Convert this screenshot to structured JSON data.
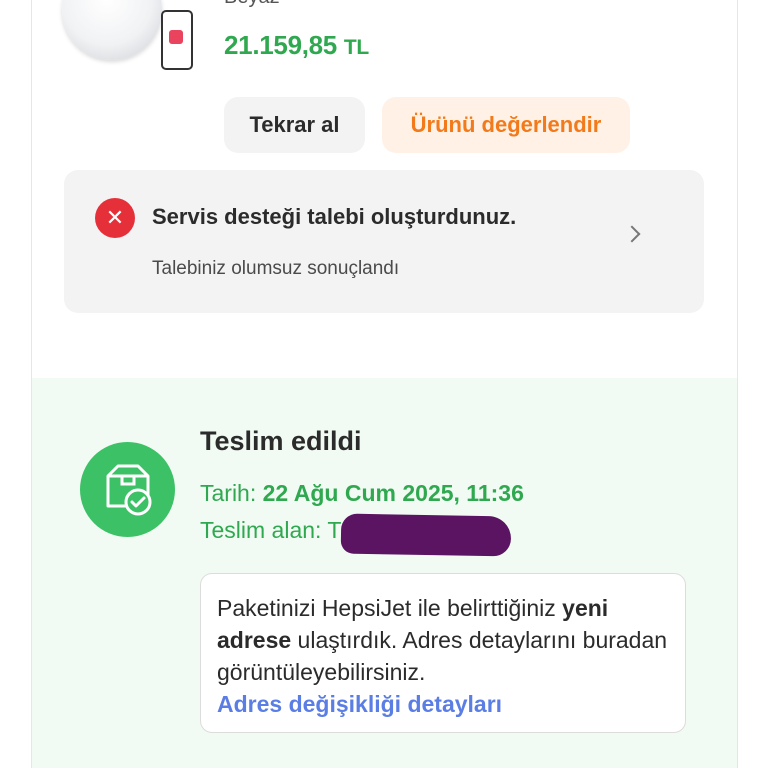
{
  "product": {
    "variant": "Beyaz",
    "price_amount": "21.159,85",
    "price_currency": "TL"
  },
  "actions": {
    "rebuy_label": "Tekrar al",
    "rate_label": "Ürünü değerlendir"
  },
  "service": {
    "title": "Servis desteği talebi oluşturdunuz.",
    "subtitle": "Talebiniz olumsuz sonuçlandı",
    "status_icon": "close-icon"
  },
  "delivery": {
    "status": "Teslim edildi",
    "date_label": "Tarih:",
    "date_value": "22 Ağu Cum 2025, 11:36",
    "receiver_label": "Teslim alan:",
    "receiver_value": "T",
    "info_part1": "Paketinizi HepsiJet ile belirttiğiniz ",
    "info_bold": "yeni adrese",
    "info_part2": " ulaştırdık. Adres detaylarını buradan görüntüleyebilirsiniz.",
    "info_link": "Adres değişikliği detayları"
  },
  "colors": {
    "price_green": "#2fa84f",
    "rate_orange": "#f27a1a",
    "error_red": "#e5303a",
    "delivered_green": "#3cc166",
    "link_blue": "#5b7ee5"
  }
}
